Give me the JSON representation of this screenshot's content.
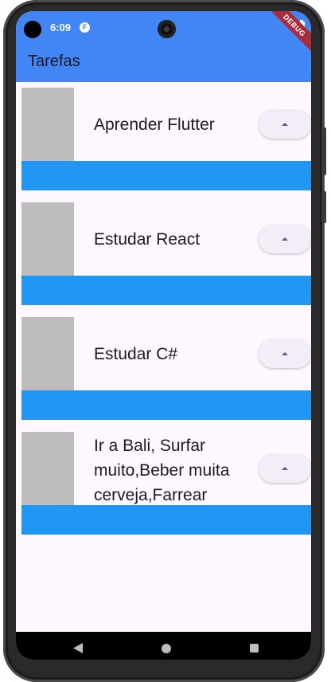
{
  "status_bar": {
    "time": "6:09",
    "debug_label": "DEBUG"
  },
  "app_bar": {
    "title": "Tarefas"
  },
  "tasks": [
    {
      "name": "Aprender Flutter"
    },
    {
      "name": "Estudar React"
    },
    {
      "name": "Estudar C#"
    },
    {
      "name": "Ir a Bali, Surfar muito,Beber muita cerveja,Farrear"
    }
  ],
  "icons": {
    "vote": "arrow-drop-up-icon",
    "wifi": "wifi-icon",
    "battery": "battery-icon",
    "back": "nav-back-icon",
    "home": "nav-home-icon",
    "recent": "nav-recent-icon"
  },
  "colors": {
    "app_bar": "#4285f4",
    "task_bar": "#2196f3",
    "image_placeholder": "#bdbdbd",
    "screen_background": "#fef7ff",
    "button_background": "#f3edf7",
    "button_icon": "#65558f",
    "debug_banner": "#a82d3a"
  }
}
